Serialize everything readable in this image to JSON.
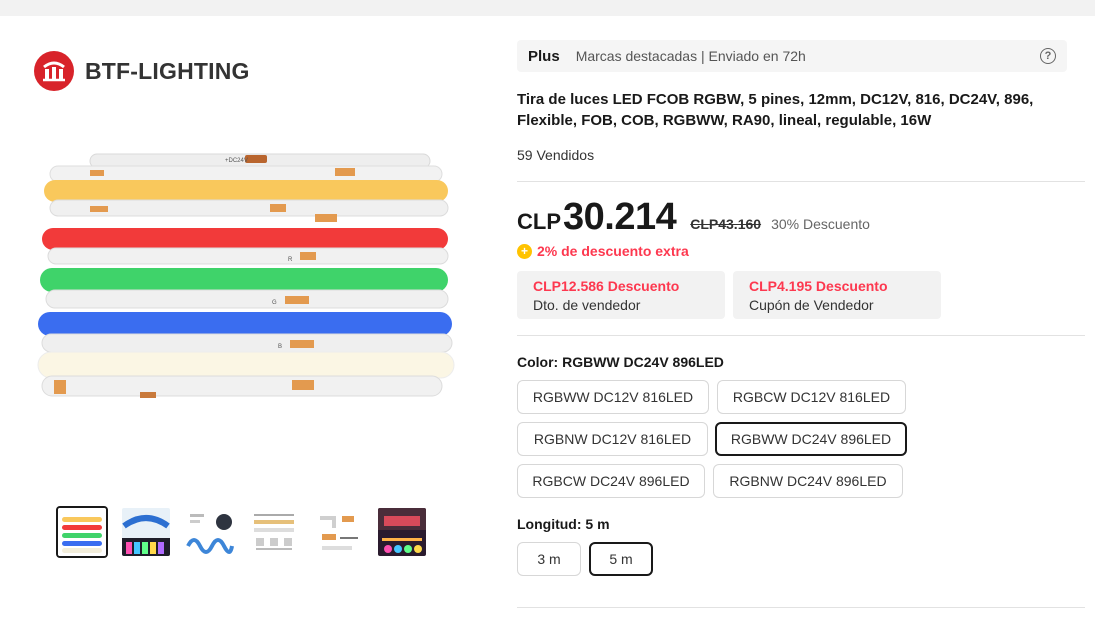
{
  "brand": {
    "name": "BTF-LIGHTING"
  },
  "gallery": {
    "thumbnails": [
      "thumb-1",
      "thumb-2",
      "thumb-3",
      "thumb-4",
      "thumb-5",
      "thumb-6"
    ],
    "main_image_labels": [
      "+DC24V",
      "R",
      "B",
      "G"
    ]
  },
  "badge": {
    "label": "Plus",
    "text": "Marcas destacadas | Enviado en 72h",
    "help": "?"
  },
  "product": {
    "title": "Tira de luces LED FCOB RGBW, 5 pines, 12mm, DC12V, 816, DC24V, 896, Flexible, FOB, COB, RGBWW, RA90, lineal, regulable, 16W",
    "sold": "59 Vendidos"
  },
  "price": {
    "currency": "CLP",
    "value": "30.214",
    "original": "CLP43.160",
    "discount": "30% Descuento"
  },
  "extra_discount": {
    "icon": "+",
    "text": "2% de descuento extra"
  },
  "coupons": [
    {
      "value": "CLP12.586 Descuento",
      "desc": "Dto. de vendedor"
    },
    {
      "value": "CLP4.195 Descuento",
      "desc": "Cupón de Vendedor"
    }
  ],
  "color": {
    "title": "Color: RGBWW DC24V 896LED",
    "options": [
      "RGBWW DC12V 816LED",
      "RGBCW DC12V 816LED",
      "RGBNW DC12V 816LED",
      "RGBWW DC24V 896LED",
      "RGBCW DC24V 896LED",
      "RGBNW DC24V 896LED"
    ],
    "selected": "RGBWW DC24V 896LED"
  },
  "length": {
    "title": "Longitud: 5 m",
    "options": [
      "3 m",
      "5 m"
    ],
    "selected": "5 m"
  },
  "colors": {
    "accent_red": "#fd384f",
    "coin_yellow": "#ffc300",
    "strip_yellow": "#f9c85c",
    "strip_red": "#f23a3a",
    "strip_green": "#3fd36a",
    "strip_blue": "#3a6df0",
    "strip_warm": "#fbf6e4"
  }
}
